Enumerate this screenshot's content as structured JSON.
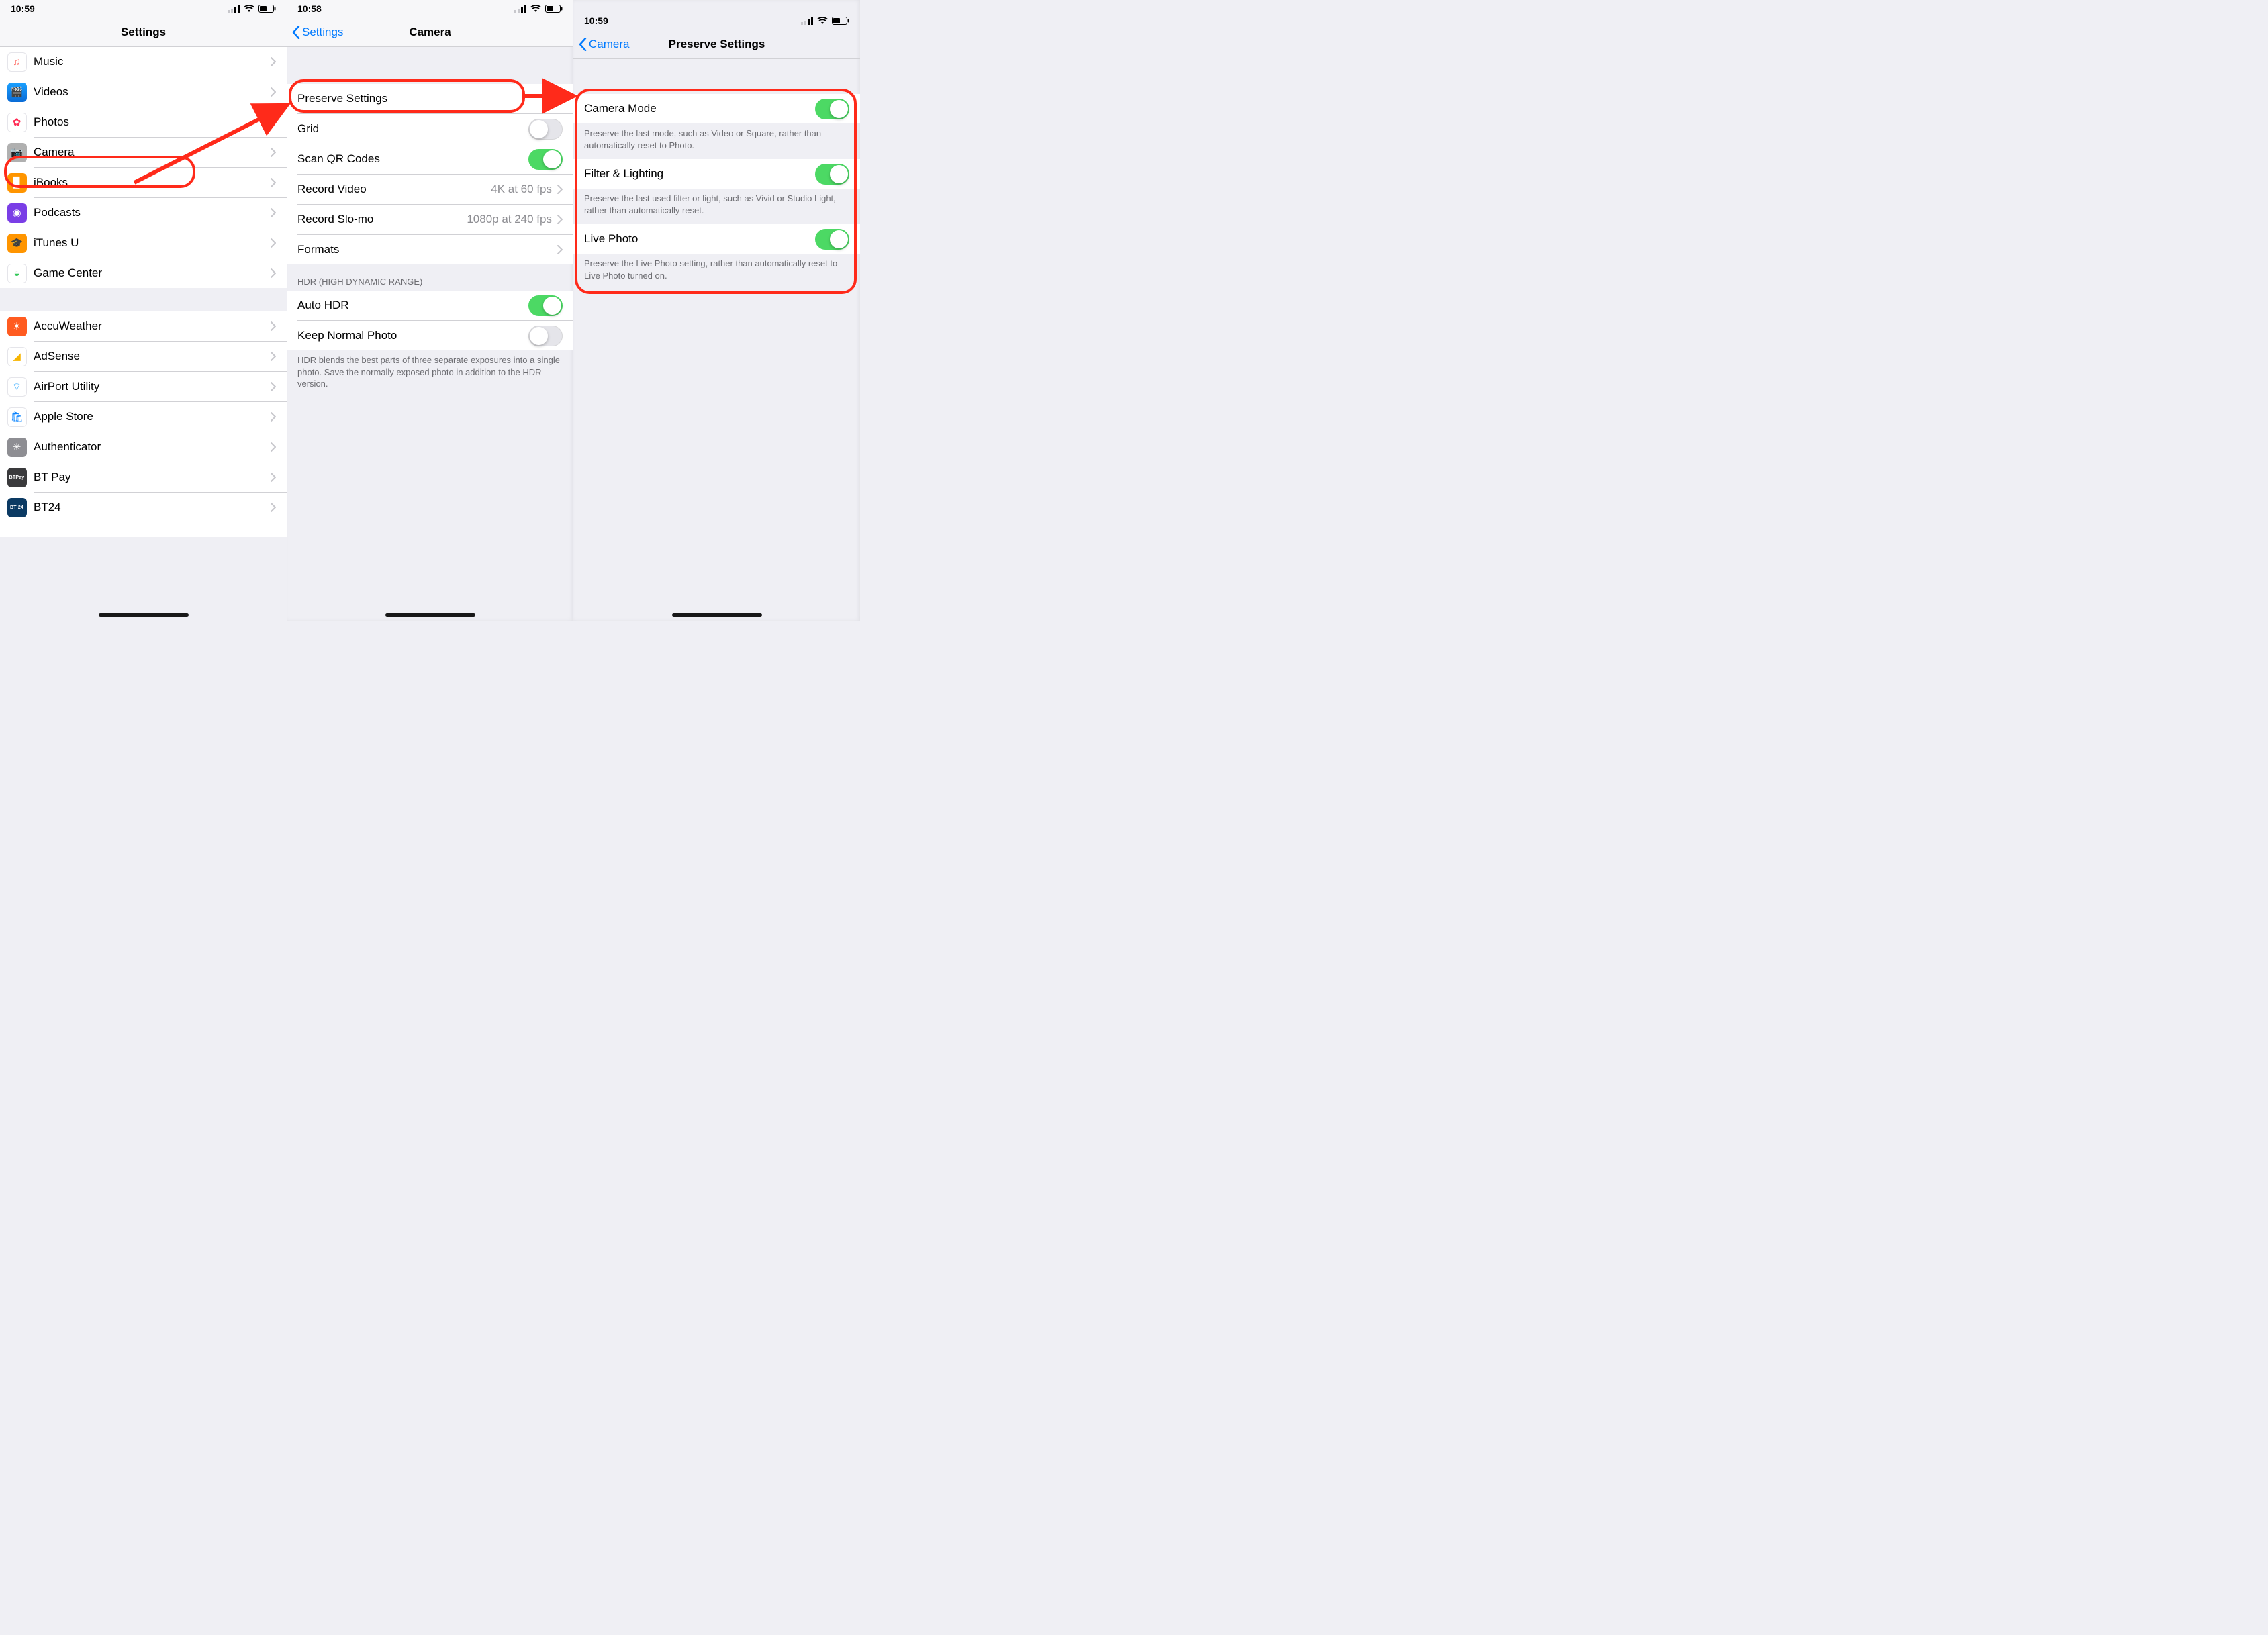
{
  "statusbar": {
    "times": [
      "10:59",
      "10:58",
      "10:59"
    ]
  },
  "screen1": {
    "title": "Settings",
    "group1": [
      {
        "label": "Music",
        "bg": "linear-gradient(180deg,#ffffff,#ffffff)",
        "glyph": "♫",
        "fg": "#ff3b30",
        "bd": "#e5e5ea"
      },
      {
        "label": "Videos",
        "bg": "linear-gradient(180deg,#1aa0ff,#0a6bd6)",
        "glyph": "🎬",
        "fg": "#fff"
      },
      {
        "label": "Photos",
        "bg": "#ffffff",
        "glyph": "✿",
        "fg": "#ff2d55",
        "bd": "#e5e5ea"
      },
      {
        "label": "Camera",
        "bg": "#b0b0b0",
        "glyph": "📷",
        "fg": "#333"
      },
      {
        "label": "iBooks",
        "bg": "#ff9500",
        "glyph": "▉",
        "fg": "#fff"
      },
      {
        "label": "Podcasts",
        "bg": "#7a3ee6",
        "glyph": "◉",
        "fg": "#fff"
      },
      {
        "label": "iTunes U",
        "bg": "#ff9500",
        "glyph": "🎓",
        "fg": "#fff"
      },
      {
        "label": "Game Center",
        "bg": "#ffffff",
        "glyph": "◒",
        "fg": "#34c759",
        "bd": "#e5e5ea"
      }
    ],
    "group2": [
      {
        "label": "AccuWeather",
        "bg": "#ff5b20",
        "glyph": "☀",
        "fg": "#fff"
      },
      {
        "label": "AdSense",
        "bg": "#ffffff",
        "glyph": "◢",
        "fg": "#f7b500",
        "bd": "#e5e5ea"
      },
      {
        "label": "AirPort Utility",
        "bg": "#ffffff",
        "glyph": "⌔",
        "fg": "#1da1ff",
        "bd": "#e5e5ea"
      },
      {
        "label": "Apple Store",
        "bg": "#ffffff",
        "glyph": "🛍",
        "fg": "#0a84ff",
        "bd": "#e5e5ea"
      },
      {
        "label": "Authenticator",
        "bg": "#8e8e93",
        "glyph": "✳",
        "fg": "#fff"
      },
      {
        "label": "BT Pay",
        "bg": "#3a3a3c",
        "glyph": "BTPay",
        "fg": "#fff",
        "small": true
      },
      {
        "label": "BT24",
        "bg": "#0b3a63",
        "glyph": "BT 24",
        "fg": "#fff",
        "small": true
      }
    ]
  },
  "screen2": {
    "backLabel": "Settings",
    "title": "Camera",
    "top": [
      {
        "type": "link",
        "label": "Preserve Settings"
      },
      {
        "type": "toggle",
        "label": "Grid",
        "on": false
      },
      {
        "type": "toggle",
        "label": "Scan QR Codes",
        "on": true
      },
      {
        "type": "link",
        "label": "Record Video",
        "value": "4K at 60 fps"
      },
      {
        "type": "link",
        "label": "Record Slo-mo",
        "value": "1080p at 240 fps"
      },
      {
        "type": "link",
        "label": "Formats"
      }
    ],
    "hdrHeader": "HDR (HIGH DYNAMIC RANGE)",
    "hdr": [
      {
        "type": "toggle",
        "label": "Auto HDR",
        "on": true
      },
      {
        "type": "toggle",
        "label": "Keep Normal Photo",
        "on": false
      }
    ],
    "hdrFooter": "HDR blends the best parts of three separate exposures into a single photo. Save the normally exposed photo in addition to the HDR version."
  },
  "screen3": {
    "backLabel": "Camera",
    "title": "Preserve Settings",
    "items": [
      {
        "label": "Camera Mode",
        "on": true,
        "footer": "Preserve the last mode, such as Video or Square, rather than automatically reset to Photo."
      },
      {
        "label": "Filter & Lighting",
        "on": true,
        "footer": "Preserve the last used filter or light, such as Vivid or Studio Light, rather than automatically reset."
      },
      {
        "label": "Live Photo",
        "on": true,
        "footer": "Preserve the Live Photo setting, rather than automatically reset to Live Photo turned on."
      }
    ]
  }
}
